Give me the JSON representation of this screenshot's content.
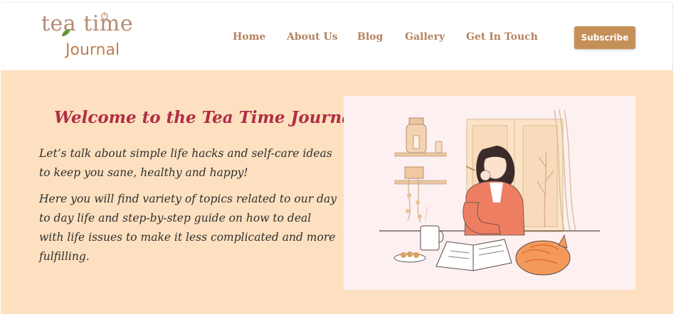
{
  "header": {
    "logo": {
      "line1": "tea time",
      "line2": "Journal"
    },
    "nav": [
      "Home",
      "About Us",
      "Blog",
      "Gallery",
      "Get In Touch"
    ],
    "subscribe_label": "Subscribe"
  },
  "hero": {
    "title": "Welcome to the Tea Time Journal!",
    "paragraph1": "Let’s talk about simple life hacks and self-care ideas to keep you sane, healthy and happy!",
    "paragraph2": "Here you will find variety of topics related to our day to day life and step-by-step guide on how to deal with life issues to make it less complicated and more fulfilling."
  },
  "colors": {
    "hero_background": "#fde0bf",
    "title": "#b12d45",
    "nav": "#b5825f",
    "subscribe_button": "#c59058",
    "illustration_background": "#fcf0f1"
  }
}
